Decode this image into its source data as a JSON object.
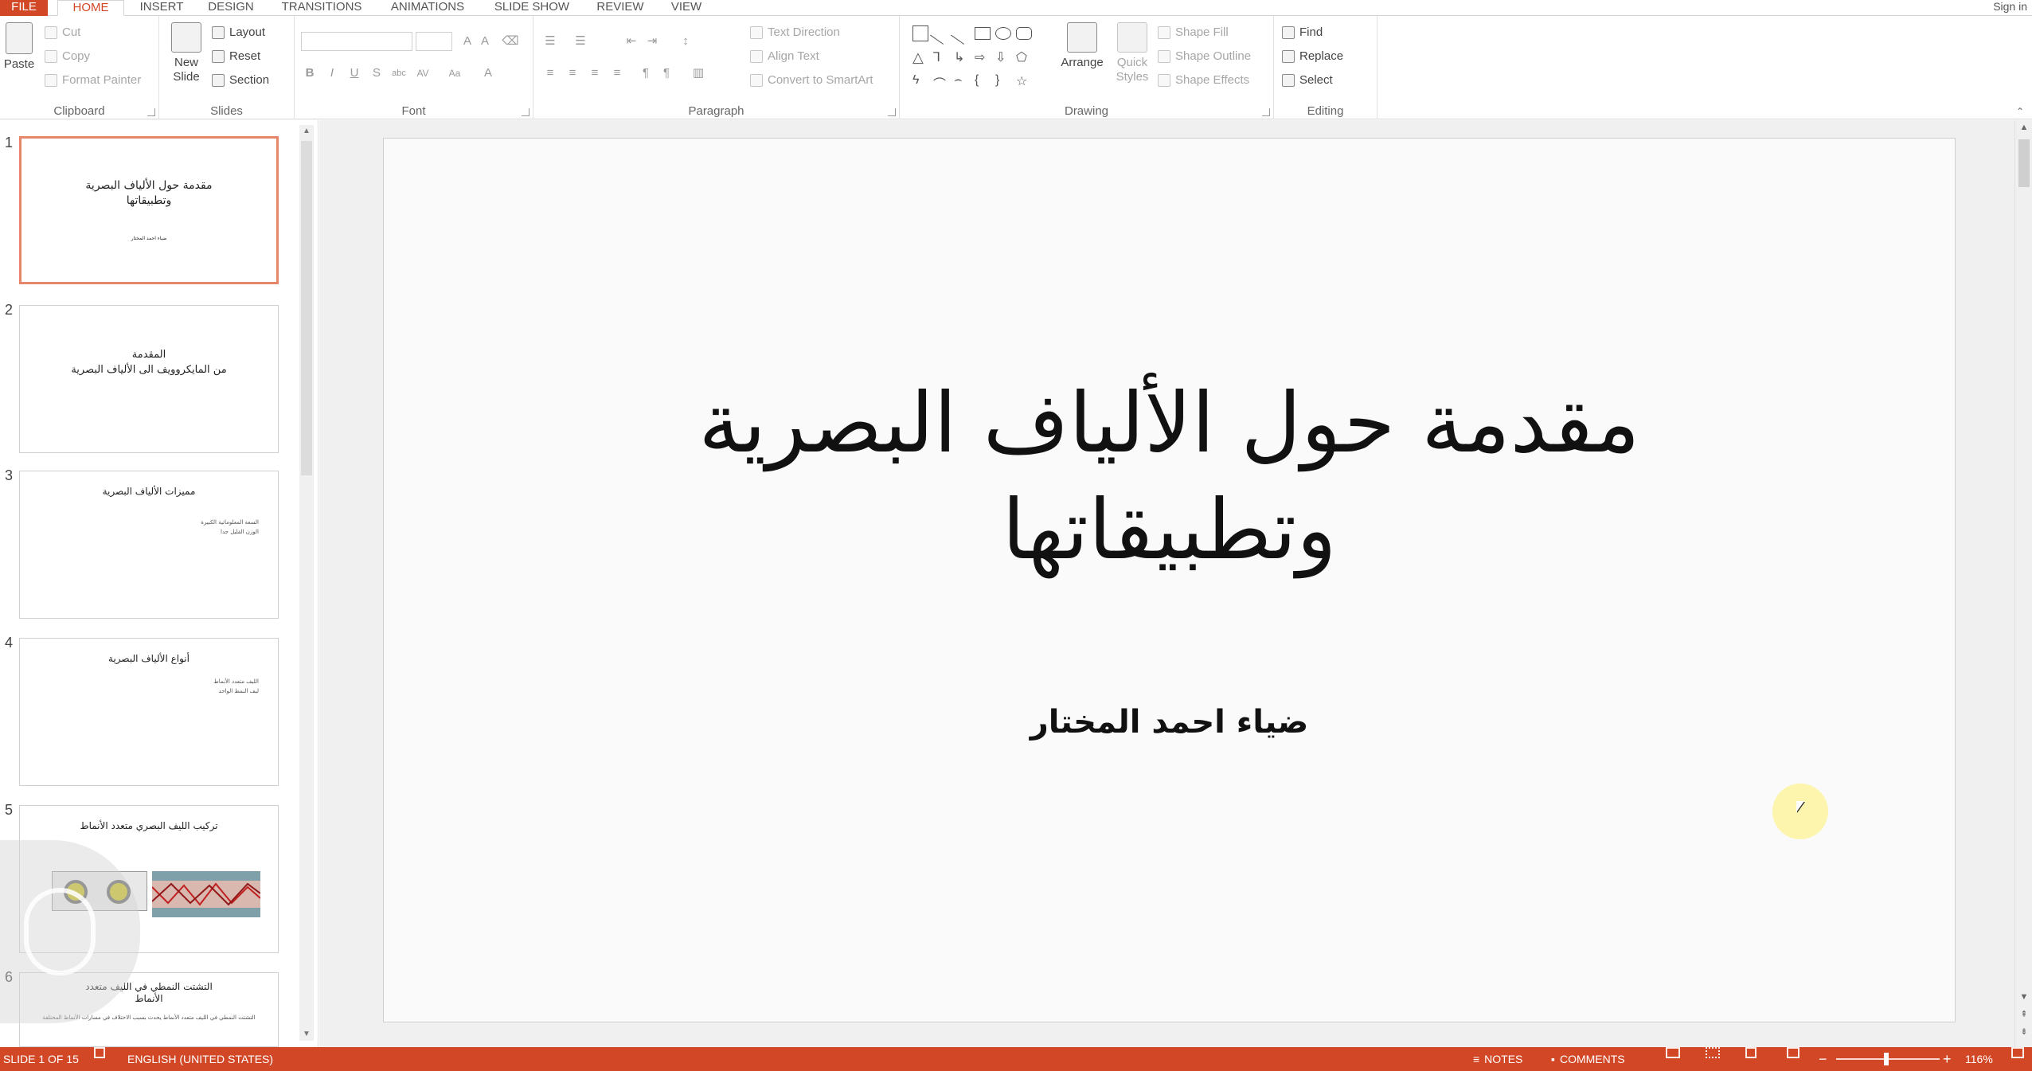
{
  "tabs": [
    {
      "label": "FILE",
      "kind": "file"
    },
    {
      "label": "HOME",
      "kind": "active"
    },
    {
      "label": "INSERT",
      "kind": ""
    },
    {
      "label": "DESIGN",
      "kind": ""
    },
    {
      "label": "TRANSITIONS",
      "kind": ""
    },
    {
      "label": "ANIMATIONS",
      "kind": ""
    },
    {
      "label": "SLIDE SHOW",
      "kind": ""
    },
    {
      "label": "REVIEW",
      "kind": ""
    },
    {
      "label": "VIEW",
      "kind": ""
    }
  ],
  "signin": "Sign in",
  "ribbon": {
    "clipboard": {
      "label": "Clipboard",
      "paste": "Paste",
      "cut": "Cut",
      "copy": "Copy",
      "format_painter": "Format Painter"
    },
    "slides": {
      "label": "Slides",
      "new_slide_1": "New",
      "new_slide_2": "Slide",
      "layout": "Layout",
      "reset": "Reset",
      "section": "Section"
    },
    "font": {
      "label": "Font"
    },
    "paragraph": {
      "label": "Paragraph",
      "text_direction": "Text Direction",
      "align_text": "Align Text",
      "convert_smartart": "Convert to SmartArt"
    },
    "drawing": {
      "label": "Drawing",
      "arrange": "Arrange",
      "quick_styles_1": "Quick",
      "quick_styles_2": "Styles",
      "shape_fill": "Shape Fill",
      "shape_outline": "Shape Outline",
      "shape_effects": "Shape Effects"
    },
    "editing": {
      "label": "Editing",
      "find": "Find",
      "replace": "Replace",
      "select": "Select"
    }
  },
  "slides": [
    {
      "num": "1",
      "title": "مقدمة حول الألياف البصرية\nوتطبيقاتها",
      "body": "ضياء احمد المختار"
    },
    {
      "num": "2",
      "title": "المقدمة\nمن المايكروويف الى الألياف البصرية",
      "body": ""
    },
    {
      "num": "3",
      "title": "مميزات الألياف البصرية",
      "body": "السعة المعلوماتية الكبيرة\nالوزن القليل جدا"
    },
    {
      "num": "4",
      "title": "أنواع الألياف البصرية",
      "body": "الليف متعدد الأنماط\nليف النمط الواحد"
    },
    {
      "num": "5",
      "title": "تركيب الليف البصري متعدد الأنماط",
      "body": ""
    },
    {
      "num": "6",
      "title": "التشتت النمطي في الليف متعدد\nالأنماط",
      "body": "التشتت النمطي في الليف متعدد الأنماط يحدث بسبب الاختلاف في مسارات الأنماط المختلفة"
    }
  ],
  "main_slide": {
    "title": "مقدمة حول الألياف البصرية\nوتطبيقاتها",
    "subtitle": "ضياء احمد المختار"
  },
  "status": {
    "slide_info": "SLIDE 1 OF 15",
    "language": "ENGLISH (UNITED STATES)",
    "notes": "NOTES",
    "comments": "COMMENTS",
    "zoom": "116%"
  },
  "colors": {
    "accent": "#d24726",
    "selected_thumb_border": "#e8866b"
  }
}
